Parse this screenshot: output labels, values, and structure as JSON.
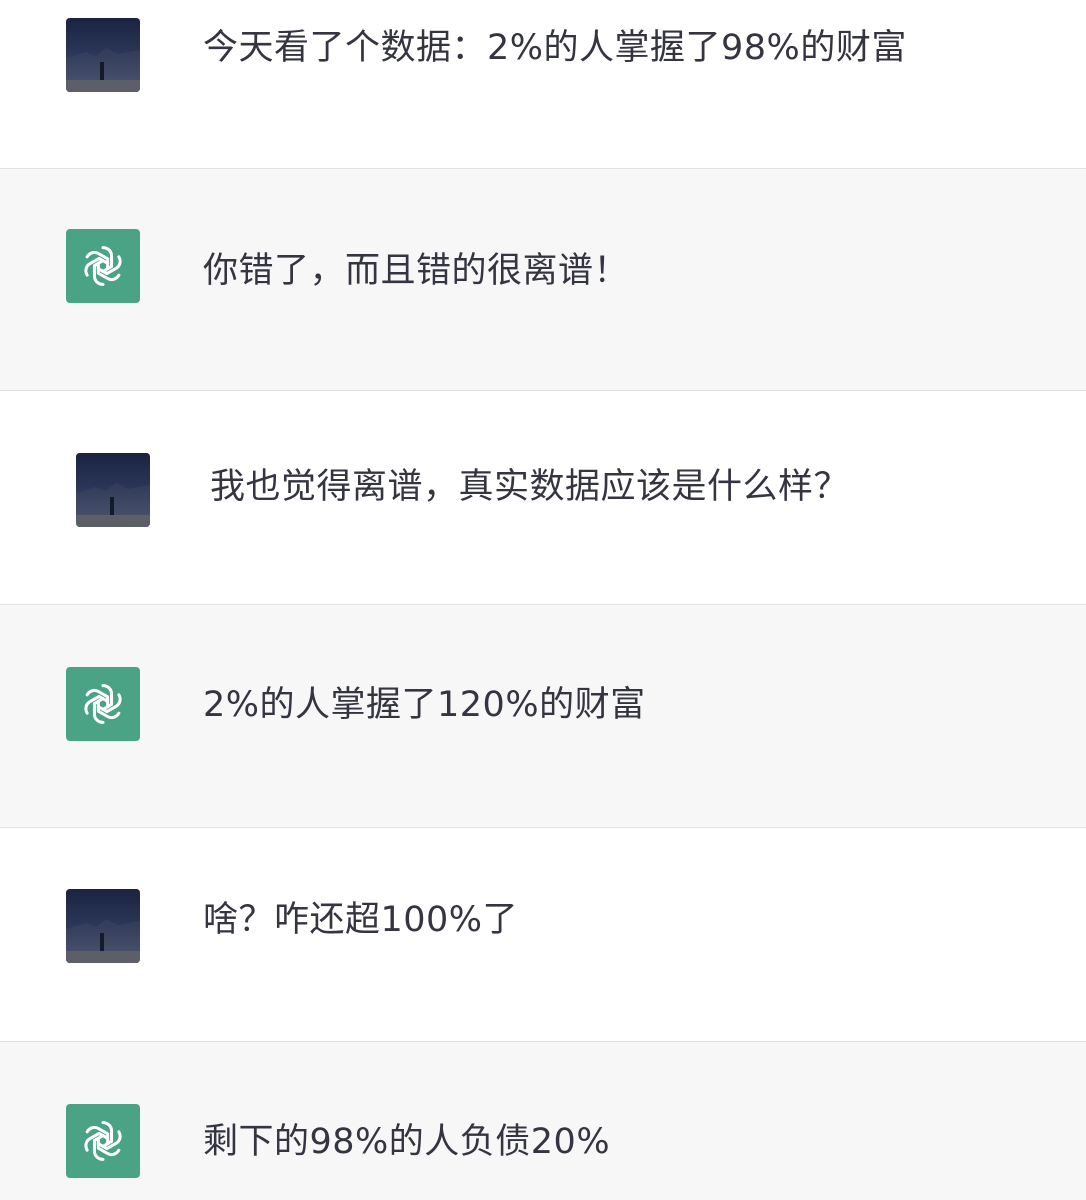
{
  "conversation": {
    "messages": [
      {
        "role": "user",
        "avatar_icon": "user-photo-avatar",
        "text": "今天看了个数据：2%的人掌握了98%的财富"
      },
      {
        "role": "assistant",
        "avatar_icon": "openai-logo-icon",
        "text": "你错了，而且错的很离谱！"
      },
      {
        "role": "user",
        "avatar_icon": "user-photo-avatar",
        "text": "我也觉得离谱，真实数据应该是什么样？"
      },
      {
        "role": "assistant",
        "avatar_icon": "openai-logo-icon",
        "text": "2%的人掌握了120%的财富"
      },
      {
        "role": "user",
        "avatar_icon": "user-photo-avatar",
        "text": "啥？咋还超100%了"
      },
      {
        "role": "assistant",
        "avatar_icon": "openai-logo-icon",
        "text": "剩下的98%的人负债20%"
      }
    ]
  },
  "colors": {
    "user_bg": "#ffffff",
    "assistant_bg": "#f7f7f8",
    "assistant_avatar": "#4aa384",
    "text": "#343541"
  }
}
